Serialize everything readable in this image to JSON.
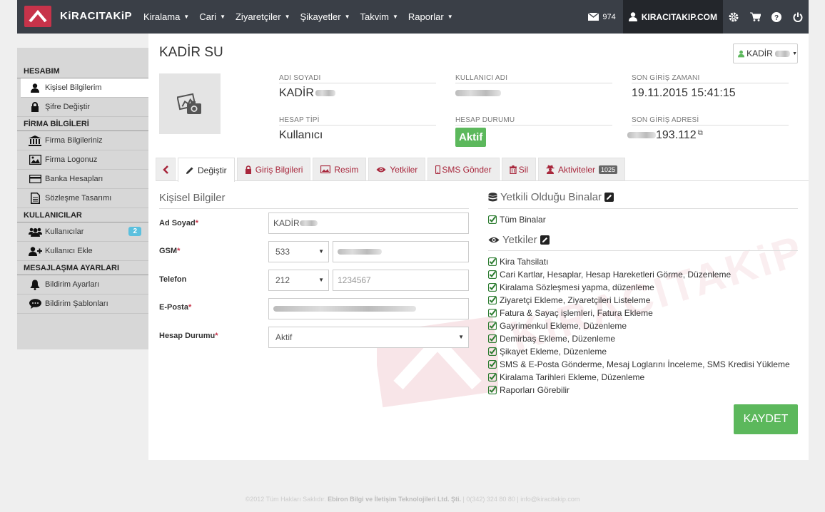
{
  "brand": {
    "name": "KiRACITAKiP",
    "color": "#c7334a"
  },
  "nav": [
    "Kiralama",
    "Cari",
    "Ziyaretçiler",
    "Şikayetler",
    "Takvim",
    "Raporlar"
  ],
  "topbar": {
    "messages_count": "974",
    "user_label": "KIRACITAKIP.COM",
    "icons": [
      "envelope-icon",
      "user-icon",
      "gear-icon",
      "cart-icon",
      "question-icon",
      "power-icon"
    ]
  },
  "sidebar": {
    "sections": [
      {
        "title": "HESABIM",
        "items": [
          {
            "label": "Kişisel Bilgilerim",
            "icon": "user-icon",
            "active": true
          },
          {
            "label": "Şifre Değiştir",
            "icon": "lock-icon"
          }
        ]
      },
      {
        "title": "FİRMA BİLGİLERİ",
        "items": [
          {
            "label": "Firma Bilgileriniz",
            "icon": "bank-icon"
          },
          {
            "label": "Firma Logonuz",
            "icon": "image-icon"
          },
          {
            "label": "Banka Hesapları",
            "icon": "credit-card-icon"
          },
          {
            "label": "Sözleşme Tasarımı",
            "icon": "document-icon"
          }
        ]
      },
      {
        "title": "KULLANICILAR",
        "items": [
          {
            "label": "Kullanıcılar",
            "icon": "users-icon",
            "badge": "2"
          },
          {
            "label": "Kullanıcı Ekle",
            "icon": "user-add-icon"
          }
        ]
      },
      {
        "title": "MESAJLAŞMA AYARLARI",
        "items": [
          {
            "label": "Bildirim Ayarları",
            "icon": "bell-icon"
          },
          {
            "label": "Bildirim Şablonları",
            "icon": "comment-icon"
          }
        ]
      }
    ]
  },
  "profile": {
    "title": "KADİR SU",
    "dropdown_label": "KADİR",
    "fields": {
      "name_label": "ADI SOYADI",
      "name_value": "KADİR",
      "username_label": "KULLANICI ADI",
      "username_value": "",
      "last_login_label": "SON GİRİŞ ZAMANI",
      "last_login_value": "19.11.2015 15:41:15",
      "type_label": "HESAP TİPİ",
      "type_value": "Kullanıcı",
      "status_label": "HESAP DURUMU",
      "status_value": "Aktif",
      "ip_label": "SON GİRİŞ ADRESİ",
      "ip_value": "193.112"
    }
  },
  "tabs": [
    {
      "label": "",
      "icon": "chevron-left-icon"
    },
    {
      "label": "Değiştir",
      "icon": "pencil-icon",
      "active": true
    },
    {
      "label": "Giriş Bilgileri",
      "icon": "lock-icon"
    },
    {
      "label": "Resim",
      "icon": "image-icon"
    },
    {
      "label": "Yetkiler",
      "icon": "eye-icon"
    },
    {
      "label": "SMS Gönder",
      "icon": "mobile-icon"
    },
    {
      "label": "Sil",
      "icon": "trash-icon"
    },
    {
      "label": "Aktiviteler",
      "icon": "user-secret-icon",
      "count": "1025"
    }
  ],
  "form": {
    "title": "Kişisel Bilgiler",
    "adsoyad_label": "Ad Soyad",
    "adsoyad_value": "KADİR",
    "gsm_label": "GSM",
    "gsm_code": "533",
    "telefon_label": "Telefon",
    "telefon_code": "212",
    "telefon_placeholder": "1234567",
    "eposta_label": "E-Posta",
    "durum_label": "Hesap Durumu",
    "durum_value": "Aktif"
  },
  "right": {
    "buildings_title": "Yetkili Olduğu Binalar",
    "buildings": [
      "Tüm Binalar"
    ],
    "perms_title": "Yetkiler",
    "perms": [
      "Kira Tahsilatı",
      "Cari Kartlar, Hesaplar, Hesap Hareketleri Görme, Düzenleme",
      "Kiralama Sözleşmesi yapma, düzenleme",
      "Ziyaretçi Ekleme, Ziyaretçileri Listeleme",
      "Fatura & Sayaç işlemleri, Fatura Ekleme",
      "Gayrimenkul Ekleme, Düzenleme",
      "Demirbaş Ekleme, Düzenleme",
      "Şikayet Ekleme, Düzenleme",
      "SMS & E-Posta Gönderme, Mesaj Loglarını İnceleme, SMS Kredisi Yükleme",
      "Kiralama Tarihleri Ekleme, Düzenleme",
      "Raporları Görebilir"
    ]
  },
  "save_label": "KAYDET",
  "watermark_text": "KiRACITAKiP",
  "footer": {
    "prefix": "©2012 Tüm Hakları Saklıdır.",
    "company": "Ebiron Bilgi ve İletişim Teknolojileri Ltd. Şti.",
    "suffix": "| 0(342) 324 80 80 | info@kiracitakip.com"
  }
}
